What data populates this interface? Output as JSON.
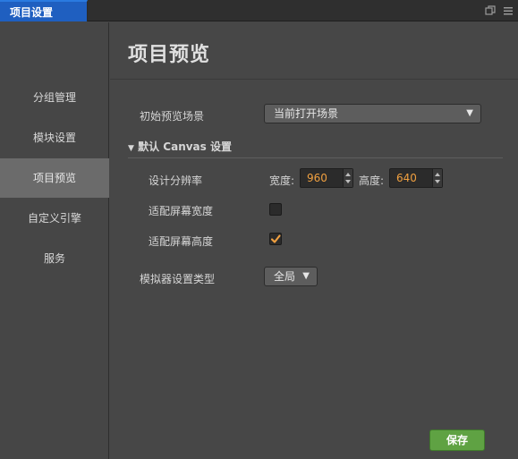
{
  "tab": {
    "title": "项目设置"
  },
  "sidebar": {
    "items": [
      {
        "label": "分组管理"
      },
      {
        "label": "模块设置"
      },
      {
        "label": "项目预览"
      },
      {
        "label": "自定义引擎"
      },
      {
        "label": "服务"
      }
    ],
    "active_index": 2
  },
  "main": {
    "title": "项目预览",
    "initial_scene": {
      "label": "初始预览场景",
      "value": "当前打开场景"
    },
    "canvas_section": {
      "header": "默认 Canvas 设置"
    },
    "resolution": {
      "label": "设计分辨率",
      "width_label": "宽度:",
      "width_value": "960",
      "height_label": "高度:",
      "height_value": "640"
    },
    "fit_width": {
      "label": "适配屏幕宽度",
      "checked": false
    },
    "fit_height": {
      "label": "适配屏幕高度",
      "checked": true
    },
    "simulator": {
      "label": "模拟器设置类型",
      "value": "全局"
    },
    "save_label": "保存"
  },
  "colors": {
    "tab_active": "#1f5fc0",
    "number_text": "#f0a040",
    "check_mark": "#f0a040",
    "save_button": "#5fa243"
  },
  "icons": [
    "restore-icon",
    "menu-icon",
    "dropdown-arrow-icon",
    "collapse-triangle-icon",
    "checkmark-icon"
  ]
}
